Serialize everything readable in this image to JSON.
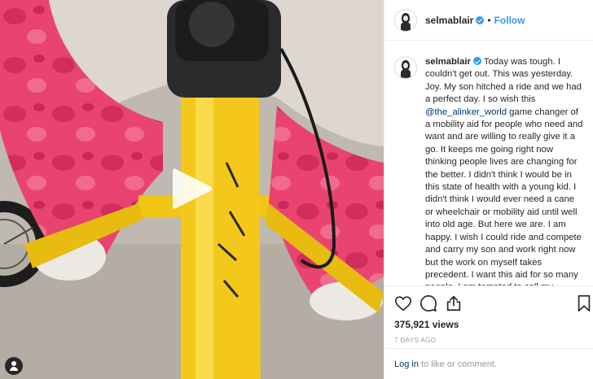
{
  "post": {
    "username": "selmablair",
    "follow_label": "Follow",
    "separator": "•",
    "caption": {
      "text_before_mention": "Today was tough. I couldn't get out. This was yesterday. Joy. My son hitched a ride and we had a perfect day. I so wish this ",
      "mention": "@the_alinker_world",
      "text_after_mention": " game changer of a mobility aid for people who need and want and are willing to really give it a go. It keeps me going right now thinking people lives are changing for the better. I didn't think I would be in this state of health with a young kid. I didn't think I would ever need a cane or wheelchair or mobility aid until well into old age. But here we are. I am happy. I wish I could ride and compete and carry my son and work right now but the work on myself takes precedent. I want this aid for so many people. I am tempted to call my friends and ask? Can we give an"
    },
    "views": "375,921 views",
    "time_ago": "7 DAYS AGO",
    "comment_login": "Log in",
    "comment_rest": " to like or comment."
  },
  "icons": {
    "like": "heart-icon",
    "comment": "comment-icon",
    "share": "share-icon",
    "save": "bookmark-icon",
    "play": "play-icon",
    "tags": "user-tag-icon",
    "verified": "verified-badge-icon"
  },
  "colors": {
    "accent": "#3897f0",
    "mention": "#003569",
    "muted": "#999999",
    "border": "#efefef"
  }
}
